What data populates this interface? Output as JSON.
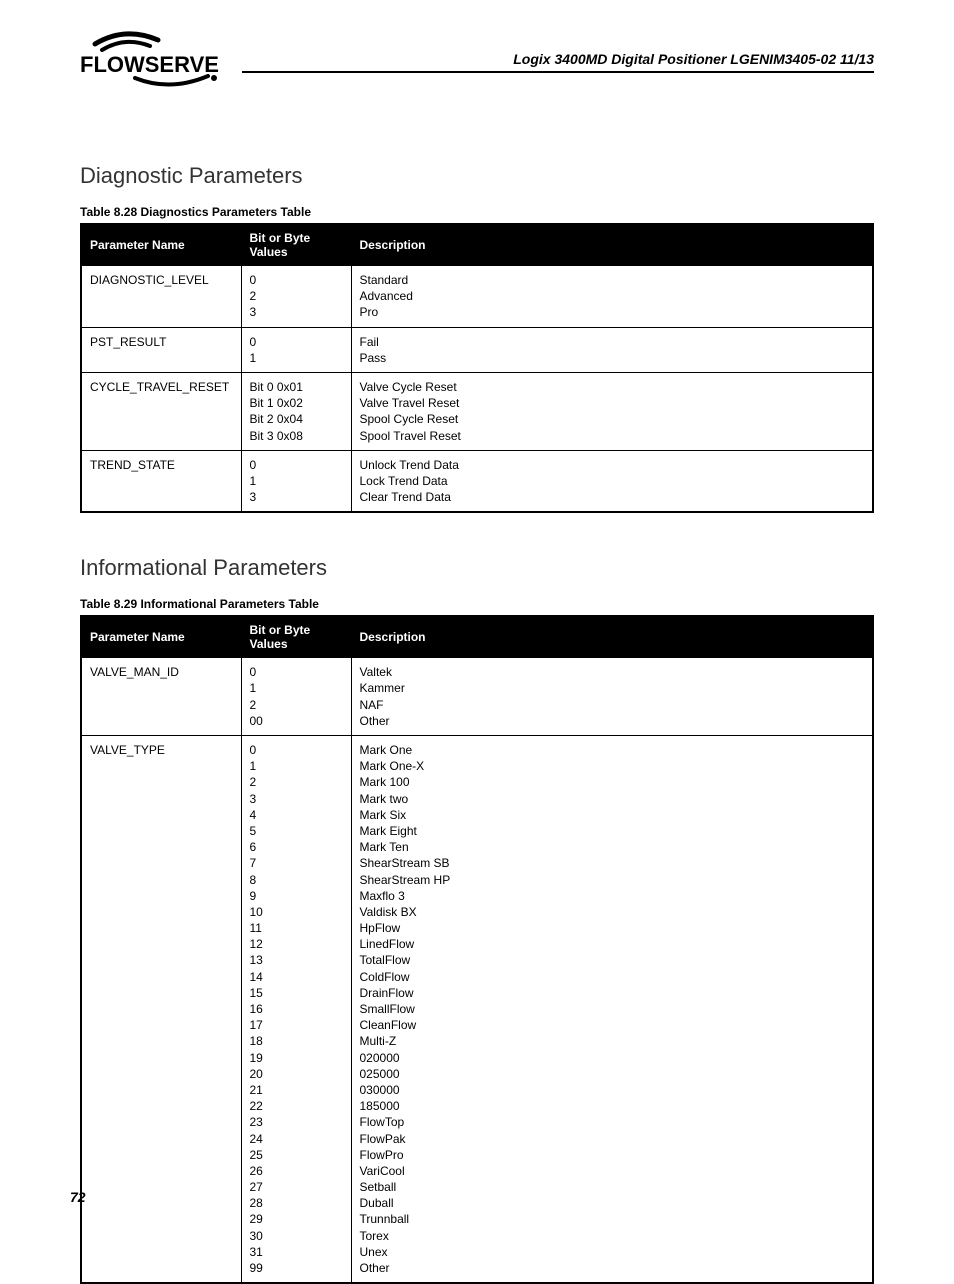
{
  "header": {
    "logo_text": "FLOWSERVE",
    "doc_title": "Logix 3400MD Digital Positioner LGENIM3405-02 11/13"
  },
  "sections": [
    {
      "heading": "Diagnostic Parameters",
      "table_caption": "Table 8.28 Diagnostics Parameters Table",
      "columns": [
        "Parameter Name",
        "Bit or Byte Values",
        "Description"
      ],
      "rows": [
        {
          "name": "DIAGNOSTIC_LEVEL",
          "values": [
            "0",
            "2",
            "3"
          ],
          "desc": [
            "Standard",
            "Advanced",
            "Pro"
          ]
        },
        {
          "name": "PST_RESULT",
          "values": [
            "0",
            "1"
          ],
          "desc": [
            "Fail",
            "Pass"
          ]
        },
        {
          "name": "CYCLE_TRAVEL_RESET",
          "values": [
            "Bit 0 0x01",
            "Bit 1 0x02",
            "Bit 2 0x04",
            "Bit 3 0x08"
          ],
          "desc": [
            "Valve Cycle Reset",
            "Valve Travel Reset",
            "Spool Cycle Reset",
            "Spool Travel Reset"
          ]
        },
        {
          "name": "TREND_STATE",
          "values": [
            "0",
            "1",
            "3"
          ],
          "desc": [
            "Unlock Trend Data",
            "Lock Trend Data",
            "Clear Trend Data"
          ]
        }
      ]
    },
    {
      "heading": "Informational Parameters",
      "table_caption": "Table 8.29 Informational Parameters  Table",
      "columns": [
        "Parameter Name",
        "Bit or Byte Values",
        "Description"
      ],
      "rows": [
        {
          "name": "VALVE_MAN_ID",
          "values": [
            "0",
            "1",
            "2",
            "00"
          ],
          "desc": [
            "Valtek",
            "Kammer",
            "NAF",
            "Other"
          ]
        },
        {
          "name": "VALVE_TYPE",
          "values": [
            "0",
            "1",
            "2",
            "3",
            "4",
            "5",
            "6",
            "7",
            "8",
            "9",
            "10",
            "11",
            "12",
            "13",
            "14",
            "15",
            "16",
            "17",
            "18",
            "19",
            "20",
            "21",
            "22",
            "23",
            "24",
            "25",
            "26",
            "27",
            "28",
            "29",
            "30",
            "31",
            "99"
          ],
          "desc": [
            "Mark One",
            "Mark One-X",
            "Mark 100",
            "Mark two",
            "Mark Six",
            "Mark Eight",
            "Mark Ten",
            "ShearStream SB",
            "ShearStream HP",
            "Maxflo 3",
            "Valdisk BX",
            "HpFlow",
            "LinedFlow",
            "TotalFlow",
            "ColdFlow",
            "DrainFlow",
            "SmallFlow",
            "CleanFlow",
            "Multi-Z",
            "020000",
            "025000",
            "030000",
            "185000",
            "FlowTop",
            "FlowPak",
            "FlowPro",
            "VariCool",
            "Setball",
            "Duball",
            "Trunnball",
            "Torex",
            "Unex",
            "Other"
          ]
        }
      ]
    }
  ],
  "page_number": "72"
}
